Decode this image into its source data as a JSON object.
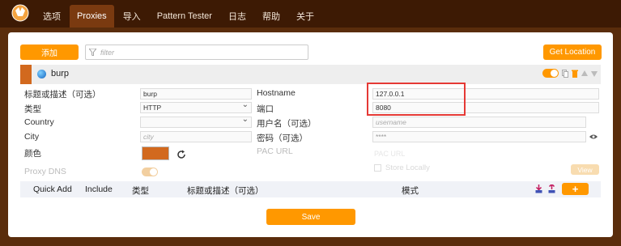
{
  "nav": {
    "tabs": [
      "选项",
      "Proxies",
      "导入",
      "Pattern Tester",
      "日志",
      "帮助",
      "关于"
    ],
    "active": "Proxies"
  },
  "toolbar": {
    "add_label": "添加",
    "filter_placeholder": "filter",
    "get_location_label": "Get Location"
  },
  "proxy": {
    "name": "burp",
    "color": "#d2691e",
    "labels": {
      "title": "标题或描述（可选）",
      "type": "类型",
      "country": "Country",
      "city": "City",
      "color": "颜色",
      "proxy_dns": "Proxy DNS",
      "hostname": "Hostname",
      "port": "端口",
      "username": "用户名（可选）",
      "password": "密码（可选）",
      "pac_url": "PAC URL"
    },
    "values": {
      "title": "burp",
      "type": "HTTP",
      "country": "",
      "city_placeholder": "city",
      "hostname": "127.0.0.1",
      "port": "8080",
      "username_placeholder": "username",
      "password": "****",
      "pac_url_placeholder": "PAC URL",
      "store_locally": "Store Locally",
      "view": "View"
    }
  },
  "patterns_table": {
    "columns": [
      "Quick Add",
      "Include",
      "类型",
      "标题或描述（可选）",
      "模式"
    ],
    "add_label": "+"
  },
  "save_label": "Save",
  "colors": {
    "accent": "#ff9800",
    "highlight": "#e53935"
  }
}
